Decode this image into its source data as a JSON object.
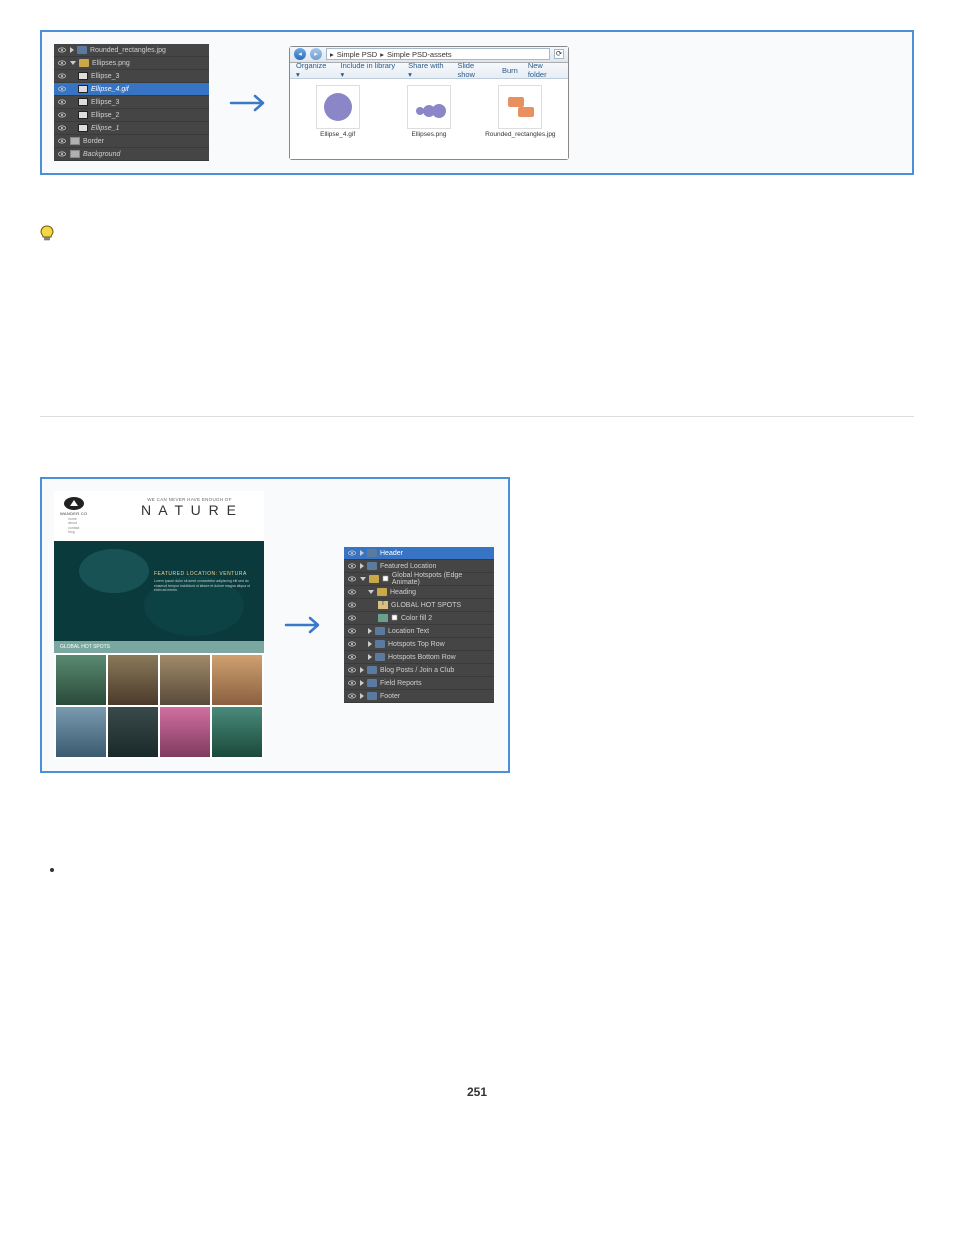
{
  "figure1": {
    "layers": [
      {
        "name": "Rounded_rectangles.jpg",
        "selected": false,
        "icon": "folder-blue",
        "triangle": "right",
        "indent": 0
      },
      {
        "name": "Ellipses.png",
        "selected": false,
        "icon": "folder-yellow",
        "triangle": "down",
        "indent": 0
      },
      {
        "name": "Ellipse_3",
        "selected": false,
        "icon": "thumb",
        "indent": 1
      },
      {
        "name": "Ellipse_4.gif",
        "selected": true,
        "icon": "thumb",
        "indent": 1,
        "italic": true
      },
      {
        "name": "Ellipse_3",
        "selected": false,
        "icon": "thumb",
        "indent": 1
      },
      {
        "name": "Ellipse_2",
        "selected": false,
        "icon": "thumb",
        "indent": 1
      },
      {
        "name": "Ellipse_1",
        "selected": false,
        "icon": "thumb",
        "indent": 1,
        "italic": true
      },
      {
        "name": "Border",
        "selected": false,
        "icon": "rect",
        "indent": 0
      },
      {
        "name": "Background",
        "selected": false,
        "icon": "rect",
        "indent": 0,
        "italic": true
      }
    ],
    "explorer": {
      "breadcrumb_root": "▸",
      "breadcrumb1": "Simple PSD",
      "breadcrumb2": "Simple PSD-assets",
      "search_btn": "⟳",
      "toolbar": {
        "organize": "Organize ▾",
        "include": "Include in library ▾",
        "share": "Share with ▾",
        "slideshow": "Slide show",
        "burn": "Burn",
        "newfolder": "New folder"
      },
      "files": [
        {
          "name": "Ellipse_4.gif",
          "thumb": "big-circle"
        },
        {
          "name": "Ellipses.png",
          "thumb": "three-circles"
        },
        {
          "name": "Rounded_rectangles.jpg",
          "thumb": "two-rects"
        }
      ]
    }
  },
  "figure2": {
    "logo_text": "WANDER.CO",
    "tagline": "WE CAN NEVER HAVE ENOUGH OF",
    "title": "N A T U R E",
    "hero_heading": "FEATURED LOCATION: VENTURA",
    "section_bar": "GLOBAL HOT SPOTS",
    "layers": [
      {
        "name": "Header",
        "selected": true,
        "icon": "folder-blue",
        "triangle": "right",
        "indent": 0
      },
      {
        "name": "Featured Location",
        "icon": "folder-blue",
        "triangle": "right",
        "indent": 0
      },
      {
        "name": "Global Hotspots (Edge Animate)",
        "icon": "folder-yellow",
        "triangle": "down",
        "indent": 0,
        "clip": true
      },
      {
        "name": "Heading",
        "icon": "folder-yellow",
        "triangle": "down",
        "indent": 1
      },
      {
        "name": "GLOBAL HOT SPOTS",
        "icon": "text",
        "indent": 2
      },
      {
        "name": "Color fill 2",
        "icon": "swatch",
        "indent": 2,
        "clip": true
      },
      {
        "name": "Location Text",
        "icon": "folder-blue",
        "triangle": "right",
        "indent": 1
      },
      {
        "name": "Hotspots Top Row",
        "icon": "folder-blue",
        "triangle": "right",
        "indent": 1
      },
      {
        "name": "Hotspots Bottom Row",
        "icon": "folder-blue",
        "triangle": "right",
        "indent": 1
      },
      {
        "name": "Blog Posts / Join a Club",
        "icon": "folder-blue",
        "triangle": "right",
        "indent": 0
      },
      {
        "name": "Field Reports",
        "icon": "folder-blue",
        "triangle": "right",
        "indent": 0
      },
      {
        "name": "Footer",
        "icon": "folder-blue",
        "triangle": "right",
        "indent": 0
      }
    ]
  },
  "page_number": "251"
}
